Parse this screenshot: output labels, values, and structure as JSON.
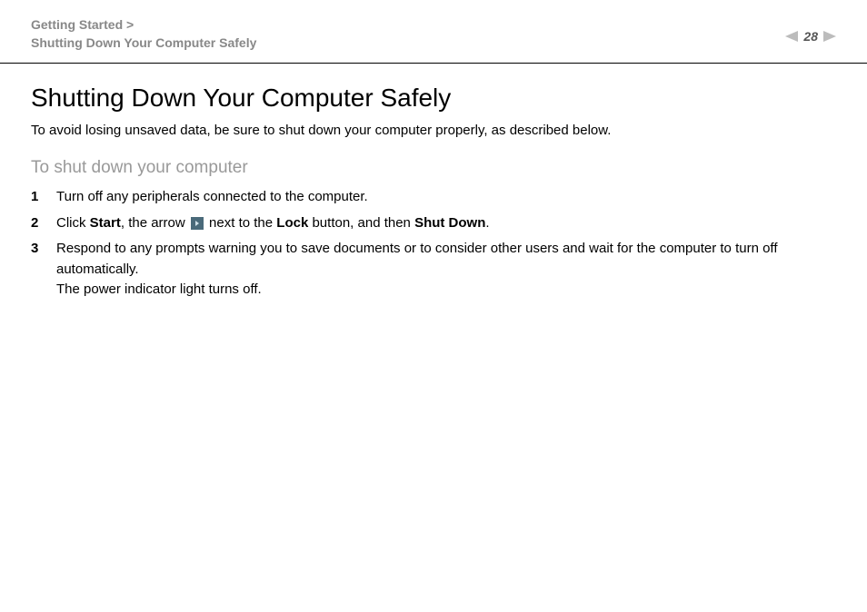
{
  "header": {
    "breadcrumb_line1": "Getting Started >",
    "breadcrumb_line2": "Shutting Down Your Computer Safely",
    "page_number": "28"
  },
  "content": {
    "title": "Shutting Down Your Computer Safely",
    "intro": "To avoid losing unsaved data, be sure to shut down your computer properly, as described below.",
    "subheading": "To shut down your computer",
    "steps": [
      {
        "num": "1",
        "segments": [
          {
            "text": "Turn off any peripherals connected to the computer."
          }
        ]
      },
      {
        "num": "2",
        "segments": [
          {
            "text": "Click "
          },
          {
            "text": "Start",
            "bold": true
          },
          {
            "text": ", the arrow "
          },
          {
            "icon": "arrow-icon"
          },
          {
            "text": " next to the "
          },
          {
            "text": "Lock",
            "bold": true
          },
          {
            "text": " button, and then "
          },
          {
            "text": "Shut Down",
            "bold": true
          },
          {
            "text": "."
          }
        ]
      },
      {
        "num": "3",
        "segments": [
          {
            "text": "Respond to any prompts warning you to save documents or to consider other users and wait for the computer to turn off automatically."
          },
          {
            "br": true
          },
          {
            "text": "The power indicator light turns off."
          }
        ]
      }
    ]
  }
}
